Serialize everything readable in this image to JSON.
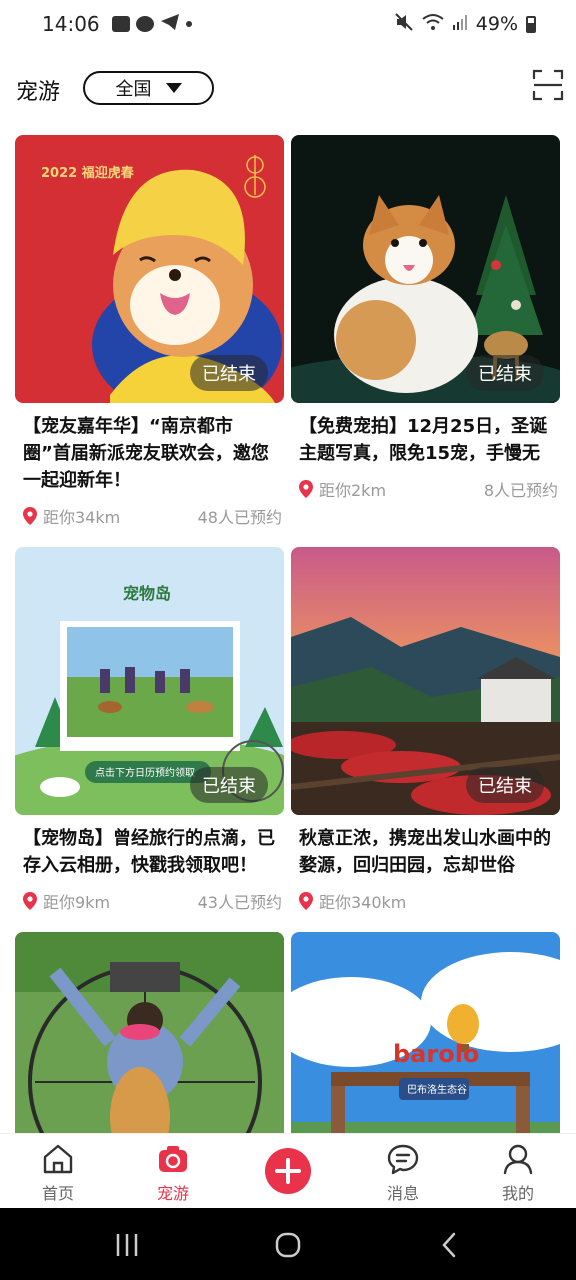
{
  "status_bar": {
    "time": "14:06",
    "battery": "49%"
  },
  "header": {
    "title": "宠游",
    "region": "全国"
  },
  "cards": [
    {
      "title": "【宠友嘉年华】“南京都市圈”首届新派宠友联欢会，邀您一起迎新年！",
      "distance": "距你34km",
      "reserved": "48人已预约",
      "badge": "已结束",
      "thumb_text": "2022 福迎虎春"
    },
    {
      "title": "【免费宠拍】12月25日，圣诞主题写真，限免15宠，手慢无",
      "distance": "距你2km",
      "reserved": "8人已预约",
      "badge": "已结束"
    },
    {
      "title": "【宠物岛】曾经旅行的点滴，已存入云相册，快戳我领取吧！",
      "distance": "距你9km",
      "reserved": "43人已预约",
      "badge": "已结束",
      "thumb_text": "宠物岛",
      "thumb_sub": "点击下方日历预约领取"
    },
    {
      "title": "秋意正浓，携宠出发山水画中的婺源，回归田园，忘却世俗",
      "distance": "距你340km",
      "reserved": "",
      "badge": "已结束"
    },
    {
      "title": "",
      "distance": "",
      "reserved": ""
    },
    {
      "title": "",
      "distance": "",
      "reserved": "",
      "thumb_text": "barolo",
      "thumb_sub": "巴布洛生态谷"
    }
  ],
  "bottom_nav": {
    "items": [
      {
        "label": "首页",
        "icon": "home-icon"
      },
      {
        "label": "宠游",
        "icon": "camera-icon",
        "active": true
      },
      {
        "label": "",
        "icon": "add-icon"
      },
      {
        "label": "消息",
        "icon": "message-icon"
      },
      {
        "label": "我的",
        "icon": "profile-icon"
      }
    ]
  },
  "colors": {
    "accent": "#e8334a",
    "text": "#111111",
    "muted": "#999999"
  }
}
